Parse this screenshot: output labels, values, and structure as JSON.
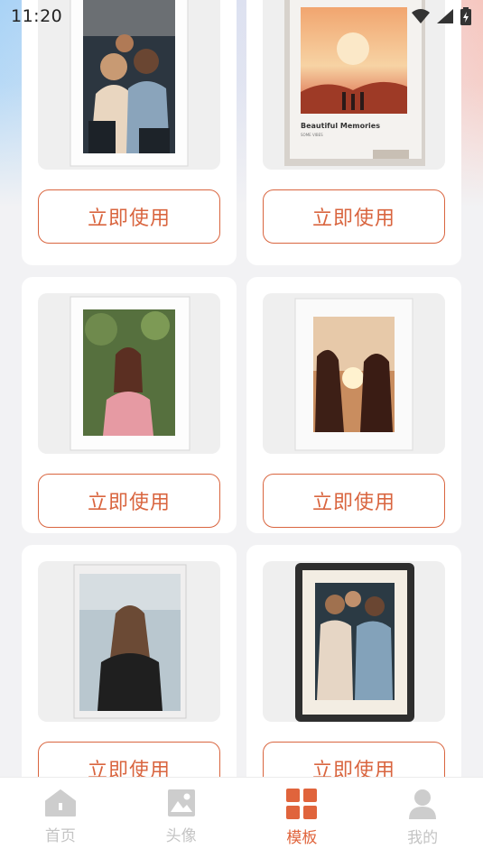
{
  "status_bar": {
    "time": "11:20",
    "icons": [
      "wifi-icon",
      "signal-icon",
      "battery-charging-icon"
    ]
  },
  "templates": [
    {
      "button_label": "立即使用",
      "style": "white-frame",
      "photo": "group-of-friends"
    },
    {
      "button_label": "立即使用",
      "style": "poster",
      "photo": "sunset-silhouettes",
      "caption": "Beautiful Memories",
      "sub_caption": "SOME VIBES"
    },
    {
      "button_label": "立即使用",
      "style": "white-frame",
      "photo": "woman-portrait"
    },
    {
      "button_label": "立即使用",
      "style": "white-frame",
      "photo": "two-women-sunset"
    },
    {
      "button_label": "立即使用",
      "style": "rough-white-frame",
      "photo": "woman-smiling"
    },
    {
      "button_label": "立即使用",
      "style": "black-frame",
      "photo": "group-of-friends"
    }
  ],
  "tab_bar": {
    "tabs": [
      {
        "label": "首页",
        "icon": "home-icon",
        "active": false
      },
      {
        "label": "头像",
        "icon": "image-icon",
        "active": false
      },
      {
        "label": "模板",
        "icon": "grid-icon",
        "active": true
      },
      {
        "label": "我的",
        "icon": "person-icon",
        "active": false
      }
    ]
  },
  "colors": {
    "accent": "#e0643c",
    "button_border": "#d9653f",
    "inactive": "#c4c4c4",
    "background": "#f2f2f4"
  }
}
